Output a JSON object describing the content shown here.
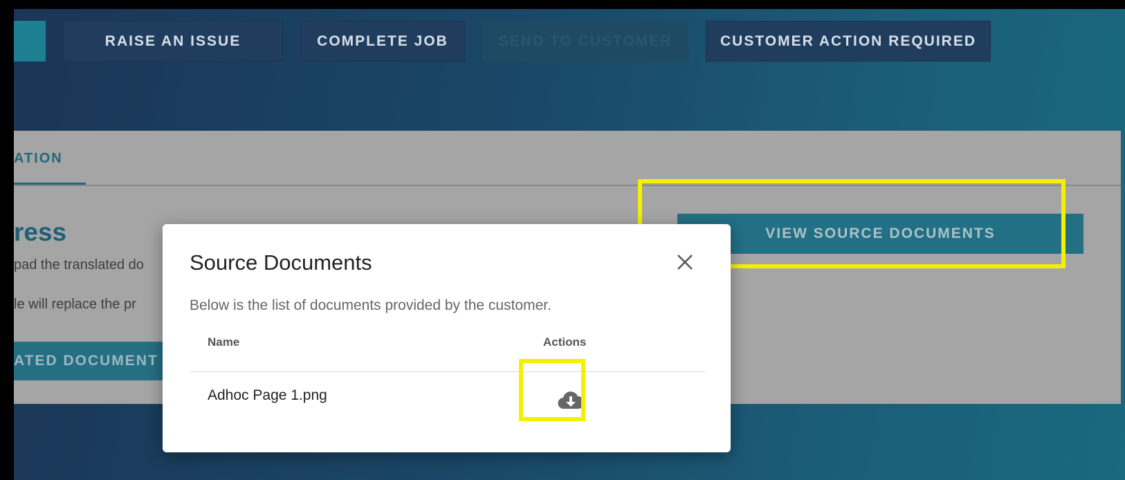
{
  "toolbar": {
    "raise_issue": "RAISE AN ISSUE",
    "complete_job": "COMPLETE JOB",
    "send_to_customer": "SEND TO CUSTOMER",
    "customer_action_required": "CUSTOMER ACTION REQUIRED"
  },
  "card": {
    "tab_label": "ATION",
    "heading": "ress",
    "line1": "pad the translated do",
    "line2": "le will replace the pr",
    "upload_button": "ATED DOCUMENT",
    "view_source_button": "VIEW SOURCE DOCUMENTS"
  },
  "modal": {
    "title": "Source Documents",
    "description": "Below is the list of documents provided by the customer.",
    "columns": {
      "name": "Name",
      "actions": "Actions"
    },
    "rows": [
      {
        "name": "Adhoc Page 1.png",
        "action_icon": "cloud-download-icon"
      }
    ],
    "close_icon": "close-icon"
  },
  "colors": {
    "highlight": "#f4f000",
    "accent": "#236f84",
    "toolbar_button": "#203d5e"
  }
}
